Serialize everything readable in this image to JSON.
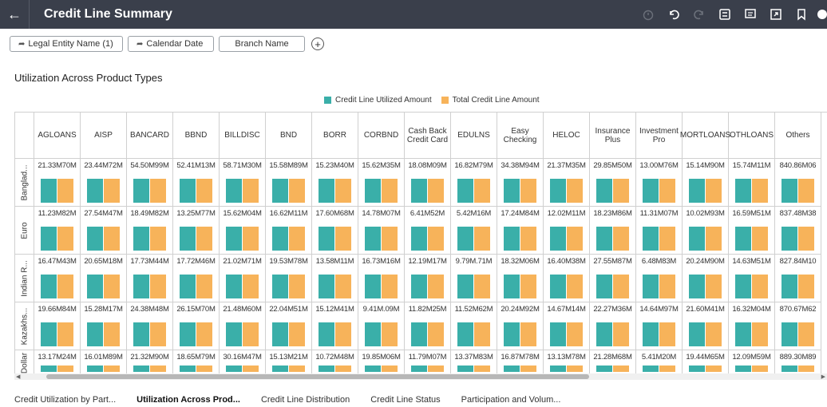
{
  "header": {
    "title": "Credit Line Summary"
  },
  "toolbar": {
    "icons": [
      "timer-icon",
      "undo-icon",
      "redo-icon",
      "data-icon",
      "comment-icon",
      "present-icon",
      "bookmark-icon",
      "user-icon"
    ]
  },
  "filters": [
    {
      "label": "Legal Entity Name (1)",
      "pinned": true
    },
    {
      "label": "Calendar Date",
      "pinned": true
    },
    {
      "label": "Branch Name",
      "pinned": false
    }
  ],
  "section": {
    "title": "Utilization Across Product Types"
  },
  "legend": [
    {
      "label": "Credit Line Utilized Amount",
      "color": "#3aafa9"
    },
    {
      "label": "Total Credit Line Amount",
      "color": "#f7b35a"
    }
  ],
  "columns": [
    "AGLOANS",
    "AISP",
    "BANCARD",
    "BBND",
    "BILLDISC",
    "BND",
    "BORR",
    "CORBND",
    "Cash Back Credit Card",
    "EDULNS",
    "Easy Checking",
    "HELOC",
    "Insurance Plus",
    "Investment Pro",
    "MORTLOANS",
    "OTHLOANS",
    "Others"
  ],
  "rows": [
    {
      "label": "Banglad...",
      "cells": [
        "21.33M​70M",
        "23.44M​72M",
        "54.50M​99M",
        "52.41M​13M",
        "58.71M​30M",
        "15.58M​89M",
        "15.23M​40M",
        "15.62M​35M",
        "18.08M​09M",
        "16.82M​79M",
        "34.38M​94M",
        "21.37M​35M",
        "29.85M​50M",
        "13.00M​76M",
        "15.14M​90M",
        "15.74M​11M",
        "840.86M​06"
      ]
    },
    {
      "label": "Euro",
      "cells": [
        "11.23M​82M",
        "27.54M​47M",
        "18.49M​82M",
        "13.25M​77M",
        "15.62M​04M",
        "16.62M​11M",
        "17.60M​68M",
        "14.78M​07M",
        "6.41M​52M",
        "5.42M​16M",
        "17.24M​84M",
        "12.02M​11M",
        "18.23M​86M",
        "11.31M​07M",
        "10.02M​93M",
        "16.59M​51M",
        "837.48M​38"
      ]
    },
    {
      "label": "Indian R...",
      "cells": [
        "16.47M​43M",
        "20.65M​18M",
        "17.73M​44M",
        "17.72M​46M",
        "21.02M​71M",
        "19.53M​78M",
        "13.58M​11M",
        "16.73M​16M",
        "12.19M​17M",
        "9.79M​.71M",
        "18.32M​06M",
        "16.40M​38M",
        "27.55M​87M",
        "6.48M​83M",
        "20.24M​90M",
        "14.63M​51M",
        "827.84M​10"
      ]
    },
    {
      "label": "Kazakhs...",
      "cells": [
        "19.66M​84M",
        "15.28M​17M",
        "24.38M​48M",
        "26.15M​70M",
        "21.48M​60M",
        "22.04M​51M",
        "15.12M​41M",
        "9.41M​.09M",
        "11.82M​25M",
        "11.52M​62M",
        "20.24M​92M",
        "14.67M​14M",
        "22.27M​36M",
        "14.64M​97M",
        "21.60M​41M",
        "16.32M​04M",
        "870.67M​62"
      ]
    },
    {
      "label": "Dollar",
      "cells": [
        "13.17M​24M",
        "16.01M​89M",
        "21.32M​90M",
        "18.65M​79M",
        "30.16M​47M",
        "15.13M​21M",
        "10.72M​48M",
        "19.85M​06M",
        "11.79M​07M",
        "13.37M​83M",
        "16.87M​78M",
        "13.13M​78M",
        "21.28M​68M",
        "5.41M​20M",
        "19.44M​65M",
        "12.09M​59M",
        "889.30M​89"
      ]
    }
  ],
  "chart_data": {
    "type": "bar",
    "title": "Utilization Across Product Types",
    "series": [
      {
        "name": "Credit Line Utilized Amount",
        "color": "#3aafa9"
      },
      {
        "name": "Total Credit Line Amount",
        "color": "#f7b35a"
      }
    ],
    "bar_ratio": [
      0.78,
      0.78
    ]
  },
  "bottom_tabs": [
    {
      "label": "Credit Utilization by Part...",
      "active": false
    },
    {
      "label": "Utilization Across Prod...",
      "active": true
    },
    {
      "label": "Credit Line Distribution",
      "active": false
    },
    {
      "label": "Credit Line Status",
      "active": false
    },
    {
      "label": "Participation and Volum...",
      "active": false
    }
  ]
}
